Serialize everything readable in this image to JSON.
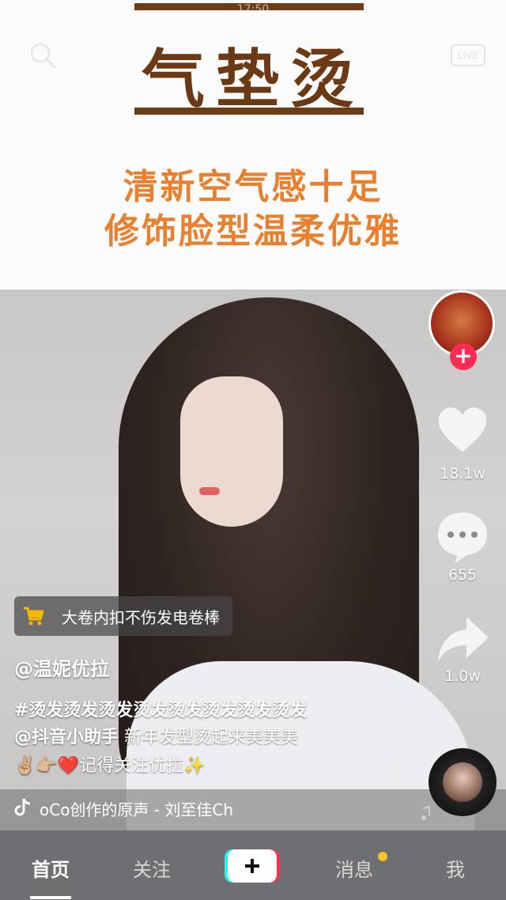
{
  "status": {
    "time": "17:50"
  },
  "top_nav": {
    "live_label": "LIVE"
  },
  "banner": {
    "title": "气垫烫",
    "line1": "清新空气感十足",
    "line2": "修饰脸型温柔优雅"
  },
  "side_rail": {
    "like_count": "18.1w",
    "comment_count": "655",
    "share_count": "1.0w"
  },
  "product": {
    "label": "大卷内扣不伤发电卷棒"
  },
  "post": {
    "author": "@温妮优拉",
    "hashtags": "#烫发烫发烫发烫发烫发烫发烫发烫发",
    "mention": "@抖音小助手",
    "line2_text": " 新年发型烫起来美美美",
    "line3_emoji": "✌🏼👉🏼❤️",
    "line3_text": "记得关注优拉",
    "line3_end": "✨"
  },
  "music": {
    "text": "oCo创作的原声 - 刘至佳Ch"
  },
  "bottom_nav": {
    "home": "首页",
    "follow": "关注",
    "create": "+",
    "messages": "消息",
    "me": "我"
  },
  "colors": {
    "follow_plus": "#fe2c55",
    "banner_title": "#6b3a15",
    "banner_text": "#e8812f",
    "message_dot": "#f7c325"
  }
}
